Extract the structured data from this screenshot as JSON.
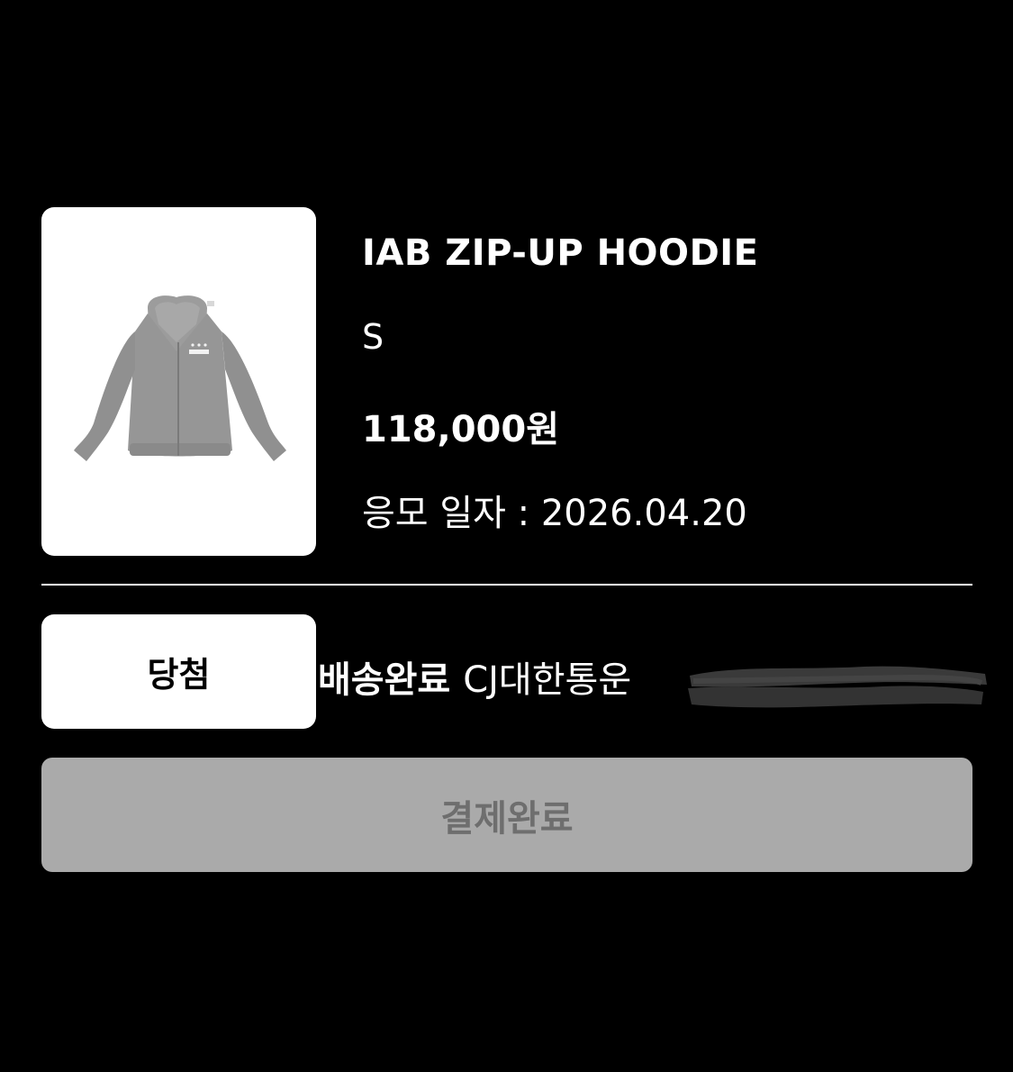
{
  "product": {
    "image_icon": "hoodie-image",
    "name": "IAB ZIP-UP HOODIE",
    "size": "S",
    "price": "118,000원",
    "apply_date": "응모 일자 : 2026.04.20"
  },
  "result": {
    "badge_label": "당첨",
    "shipping_status": "배송완료",
    "courier": "CJ대한통운"
  },
  "payment": {
    "button_label": "결제완료"
  },
  "colors": {
    "background": "#000000",
    "card": "#ffffff",
    "button_disabled": "#aaaaaa",
    "button_text": "#6e6e6e"
  }
}
